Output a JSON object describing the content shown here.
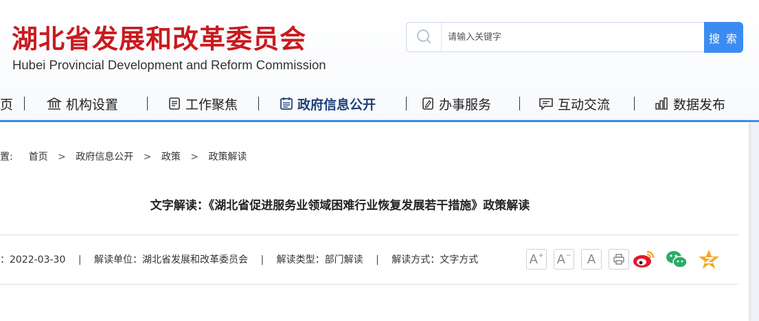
{
  "header": {
    "title": "湖北省发展和改革委员会",
    "subtitle": "Hubei Provincial Development and Reform Commission",
    "search": {
      "placeholder": "请输入关键字",
      "button_label": "搜 索"
    }
  },
  "nav": {
    "items": [
      {
        "label": "页",
        "icon": "home-icon"
      },
      {
        "label": "机构设置",
        "icon": "bank-icon"
      },
      {
        "label": "工作聚焦",
        "icon": "document-icon"
      },
      {
        "label": "政府信息公开",
        "icon": "calendar-list-icon",
        "active": true
      },
      {
        "label": "办事服务",
        "icon": "edit-icon"
      },
      {
        "label": "互动交流",
        "icon": "chat-icon"
      },
      {
        "label": "数据发布",
        "icon": "bar-chart-icon"
      }
    ]
  },
  "breadcrumb": {
    "prefix": "置:",
    "items": [
      "首页",
      "政府信息公开",
      "政策",
      "政策解读"
    ],
    "separator": ">"
  },
  "article": {
    "title": "文字解读：《湖北省促进服务业领域困难行业恢复发展若干措施》政策解读",
    "meta": {
      "date": "：2022-03-30",
      "unit": "解读单位：湖北省发展和改革委员会",
      "type": "解读类型：部门解读",
      "method": "解读方式：文字方式",
      "separator": "|"
    },
    "tools": {
      "font_larger": "A",
      "font_smaller": "A",
      "font_default": "A"
    }
  },
  "colors": {
    "brand_red": "#c91a1f",
    "accent_blue": "#3b8cf2",
    "nav_active": "#1f3f7a"
  }
}
